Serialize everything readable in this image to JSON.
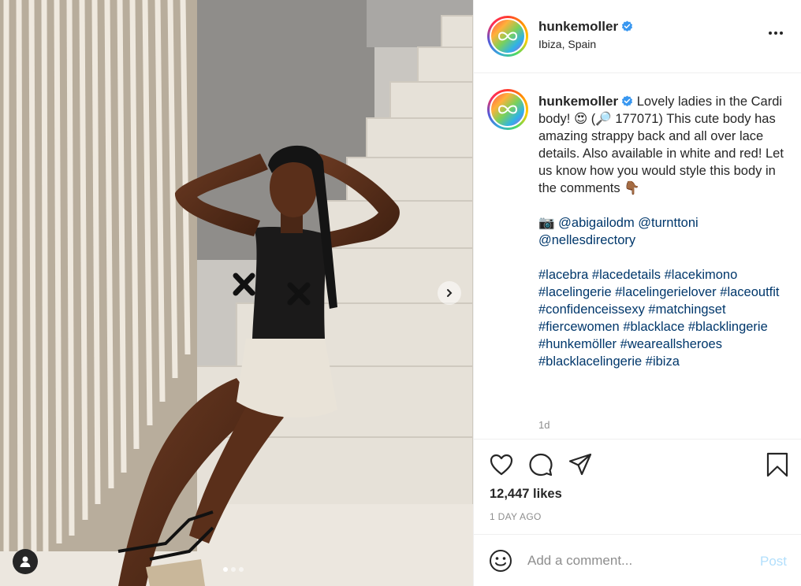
{
  "post": {
    "username": "hunkemoller",
    "location": "Ibiza, Spain",
    "caption": {
      "text_1": "Lovely ladies in the Cardi body! 😍 (🔎 177071) This cute body has amazing strappy back and all over lace details. Also available in white and red! Let us know how you would style this body in the comments 👇🏾",
      "camera_emoji": "📷",
      "mentions": [
        "@abigailodm",
        "@turnttoni",
        "@nellesdirectory"
      ],
      "hashtags": [
        "#lacebra",
        "#lacedetails",
        "#lacekimono",
        "#lacelingerie",
        "#lacelingerielover",
        "#laceoutfit",
        "#confidenceissexy",
        "#matchingset",
        "#fiercewomen",
        "#blacklace",
        "#blacklingerie",
        "#hunkemöller",
        "#weareallsheroes",
        "#blacklacelingerie",
        "#ibiza"
      ]
    },
    "time_ago": "1d",
    "likes": "12,447 likes",
    "date": "1 DAY AGO"
  },
  "comment_box": {
    "placeholder": "Add a comment...",
    "post_label": "Post"
  },
  "carousel": {
    "slide_count": 3,
    "active_index": 0
  },
  "icons": {
    "more": "more-options-icon",
    "like": "heart-icon",
    "comment": "comment-icon",
    "share": "share-icon",
    "save": "bookmark-icon",
    "emoji": "emoji-icon",
    "carousel_next": "chevron-right-icon",
    "user_tags": "user-tag-icon",
    "verified": "verified-badge-icon"
  },
  "colors": {
    "link": "#00376b",
    "verified": "#3897f0",
    "post_disabled": "#b2dffc",
    "muted": "#8e8e8e"
  }
}
